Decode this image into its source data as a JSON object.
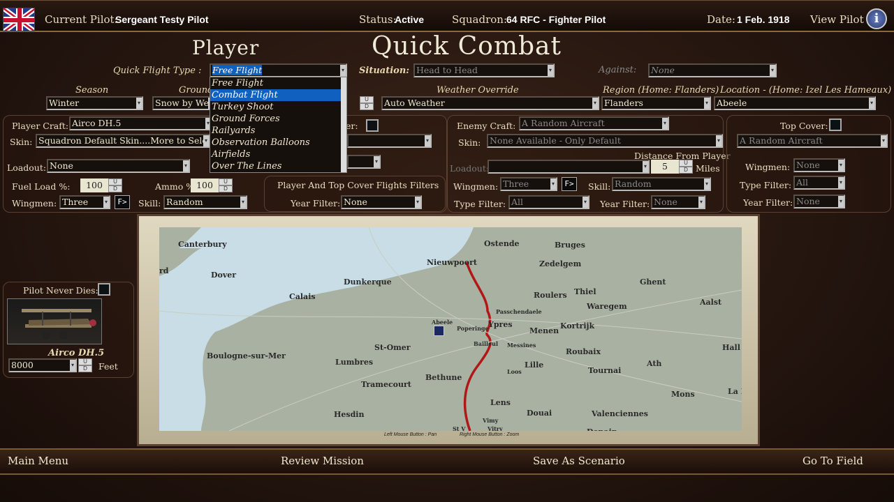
{
  "topbar": {
    "pilot_label": "Current Pilot:",
    "pilot": "Sergeant Testy Pilot",
    "status_label": "Status:",
    "status": "Active",
    "squadron_label": "Squadron:",
    "squadron": "64 RFC - Fighter Pilot",
    "date_label": "Date:",
    "date": "1 Feb. 1918",
    "view_pilot": "View Pilot",
    "info_icon": "i"
  },
  "titles": {
    "player": "Player",
    "main": "Quick Combat"
  },
  "quick_flight": {
    "label": "Quick Flight Type :",
    "value": "Free Flight",
    "options": [
      "Free Flight",
      "Combat Flight",
      "Turkey Shoot",
      "Ground Forces",
      "Railyards",
      "Observation Balloons",
      "Airfields",
      "Over The Lines"
    ],
    "highlighted": 1
  },
  "situation": {
    "label": "Situation:",
    "value": "Head to Head"
  },
  "against": {
    "label": "Against:",
    "value": "None"
  },
  "season": {
    "label": "Season",
    "value": "Winter"
  },
  "ground": {
    "label": "Ground",
    "value": "Snow by Weather"
  },
  "weather": {
    "label": "Weather Override",
    "value": "Auto Weather"
  },
  "region": {
    "label": "Region (Home: Flanders)",
    "value": "Flanders"
  },
  "location": {
    "label": "Location - (Home: Izel Les Hameaux)",
    "value": "Abeele"
  },
  "player": {
    "craft_label": "Player Craft:",
    "craft": "Airco DH.5",
    "skin_label": "Skin:",
    "skin": "Squadron Default Skin....More to Select",
    "loadout_label": "Loadout:",
    "loadout": "None",
    "fuel_label": "Fuel Load %:",
    "fuel": "100",
    "ammo_label": "Ammo %:",
    "ammo": "100",
    "wingmen_label": "Wingmen:",
    "wingmen": "Three",
    "skill_label": "Skill:",
    "skill": "Random",
    "partial_label": "er:"
  },
  "filters": {
    "title": "Player And Top Cover Flights Filters",
    "year_label": "Year Filter:",
    "year": "None"
  },
  "enemy": {
    "craft_label": "Enemy Craft:",
    "craft": "A Random Aircraft",
    "skin_label": "Skin:",
    "skin": "None Available - Only Default",
    "distance_label": "Distance From Player",
    "loadout_label": "Loadout:",
    "distance": "5",
    "miles": "Miles",
    "wingmen_label": "Wingmen:",
    "wingmen": "Three",
    "skill_label": "Skill:",
    "skill": "Random",
    "type_label": "Type Filter:",
    "type": "All",
    "year_label": "Year Filter:",
    "year": "None"
  },
  "topcover": {
    "label": "Top Cover:",
    "craft": "A Random Aircraft",
    "wingmen_label": "Wingmen:",
    "wingmen": "None",
    "type_label": "Type Filter:",
    "type": "All",
    "year_label": "Year Filter:",
    "year": "None"
  },
  "pilot_box": {
    "never_dies": "Pilot Never Dies:",
    "aircraft": "Airco DH.5",
    "altitude": "8000",
    "feet": "Feet"
  },
  "ud": {
    "u": "U",
    "d": "D"
  },
  "fbutton": "F>",
  "map": {
    "cities": [
      "Canterbury",
      "Dover",
      "Calais",
      "Dunkerque",
      "Nieuwpoort",
      "Ostende",
      "Bruges",
      "Zedelgem",
      "Thiel",
      "Roulers",
      "Ghent",
      "Waregem",
      "Aalst",
      "Abeele",
      "Poperinge",
      "Ypres",
      "Passchendaele",
      "Menen",
      "Kortrijk",
      "Bailleul",
      "Messines",
      "Roubaix",
      "St-Omer",
      "Boulogne-sur-Mer",
      "Lumbres",
      "Lille",
      "Loos",
      "Tournai",
      "Ath",
      "Hall",
      "Tramecourt",
      "Bethune",
      "Lens",
      "Mons",
      "La Lou",
      "Hesdin",
      "Douai",
      "Valenciennes",
      "Vimy",
      "Vitry",
      "St V",
      "rd",
      "Denain"
    ],
    "hint_left": "Left Mouse Button : Pan",
    "hint_right": "Right Mouse Button : Zoom"
  },
  "bottom": {
    "main_menu": "Main Menu",
    "review": "Review Mission",
    "save": "Save As Scenario",
    "go": "Go To Field"
  }
}
